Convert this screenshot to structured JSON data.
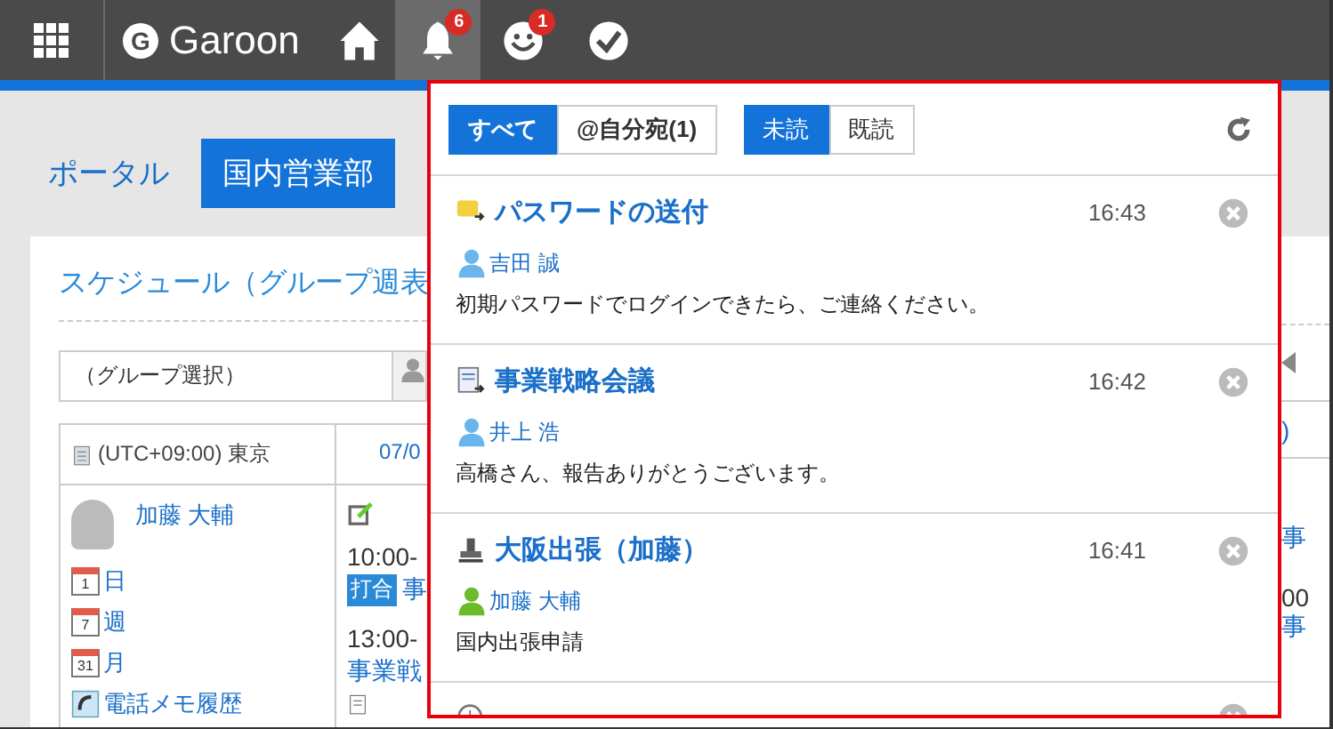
{
  "header": {
    "logo_letter": "G",
    "app_name": "Garoon",
    "icons": [
      {
        "kind": "home",
        "selected": false
      },
      {
        "kind": "bell",
        "selected": true,
        "badge": "6"
      },
      {
        "kind": "people",
        "selected": false,
        "badge": "1"
      },
      {
        "kind": "check",
        "selected": false
      }
    ]
  },
  "portal_tabs": [
    {
      "label": "ポータル",
      "selected": false
    },
    {
      "label": "国内営業部",
      "selected": true
    }
  ],
  "schedule": {
    "title": "スケジュール（グループ週表",
    "group_select": {
      "value": "（グループ選択）"
    },
    "timezone": "(UTC+09:00) 東京",
    "date_column": "07/0",
    "user": {
      "name": "加藤 大輔"
    },
    "links": [
      {
        "kind": "calendar",
        "icon_text": "1",
        "label": "日"
      },
      {
        "kind": "calendar",
        "icon_text": "7",
        "label": "週"
      },
      {
        "kind": "calendar",
        "icon_text": "31",
        "label": "月"
      },
      {
        "kind": "phone",
        "label": "電話メモ履歴"
      }
    ],
    "events": [
      {
        "time": "10:00-",
        "tag": "打合",
        "title": "事"
      },
      {
        "time": "13:00-",
        "title": "事業戦"
      }
    ],
    "right_edge_fragments": [
      ")",
      "事",
      "00",
      "事"
    ]
  },
  "notifications": {
    "filters": [
      {
        "label": "すべて",
        "selected": true
      },
      {
        "label": "@自分宛(1)",
        "selected": false
      }
    ],
    "read_filters": [
      {
        "label": "未読",
        "selected": true
      },
      {
        "label": "既読",
        "selected": false
      }
    ],
    "items": [
      {
        "kind": "message",
        "title": "パスワードの送付",
        "time": "16:43",
        "user": {
          "name": "吉田 誠",
          "color": "#6ab6ec"
        },
        "text": "初期パスワードでログインできたら、ご連絡ください。"
      },
      {
        "kind": "report",
        "title": "事業戦略会議",
        "time": "16:42",
        "user": {
          "name": "井上 浩",
          "color": "#6ab6ec"
        },
        "text": "高橋さん、報告ありがとうございます。"
      },
      {
        "kind": "workflow",
        "title": "大阪出張（加藤）",
        "time": "16:41",
        "user": {
          "name": "加藤 大輔",
          "color": "#6cbb2a"
        },
        "text": "国内出張申請"
      },
      {
        "kind": "schedule"
      }
    ]
  }
}
